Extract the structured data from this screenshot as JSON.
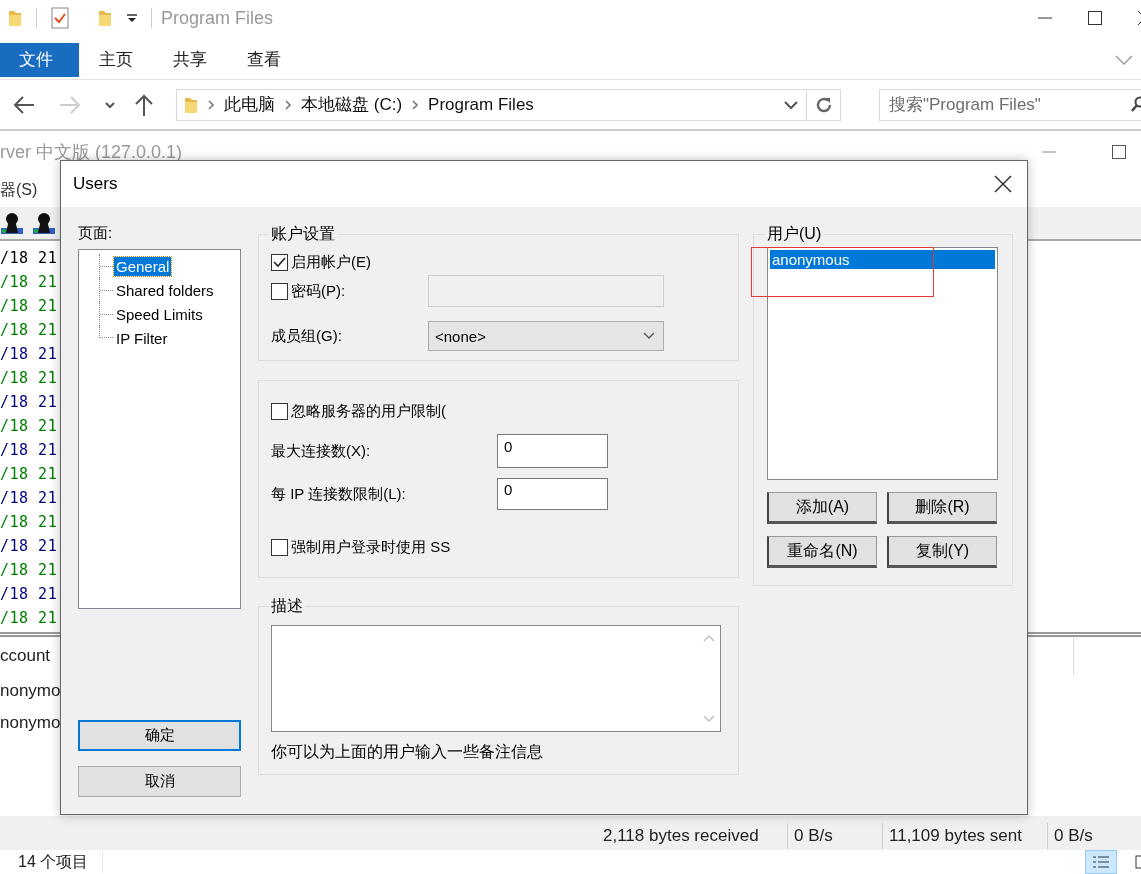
{
  "explorer": {
    "title": "Program Files",
    "ribbon_tabs": [
      {
        "label": "文件",
        "selected": true
      },
      {
        "label": "主页",
        "selected": false
      },
      {
        "label": "共享",
        "selected": false
      },
      {
        "label": "查看",
        "selected": false
      }
    ],
    "nav_buttons": [
      {
        "kind": "back",
        "disabled": false
      },
      {
        "kind": "forward",
        "disabled": true
      },
      {
        "kind": "recent",
        "disabled": false
      },
      {
        "kind": "up",
        "disabled": false
      }
    ],
    "breadcrumb": [
      "此电脑",
      "本地磁盘 (C:)",
      "Program Files"
    ],
    "search": {
      "placeholder": "搜索\"Program Files\""
    },
    "status": "14 个项目"
  },
  "server_window": {
    "title": "rver 中文版 (127.0.0.1)",
    "menu": [
      "器(S)"
    ],
    "log_lines": [
      {
        "text": "/18 21",
        "color": "#000000"
      },
      {
        "text": "/18 21",
        "color": "#008000"
      },
      {
        "text": "/18 21",
        "color": "#008000"
      },
      {
        "text": "/18 21",
        "color": "#008000"
      },
      {
        "text": "/18 21",
        "color": "#000080"
      },
      {
        "text": "/18 21",
        "color": "#008000"
      },
      {
        "text": "/18 21",
        "color": "#000080"
      },
      {
        "text": "/18 21",
        "color": "#008000"
      },
      {
        "text": "/18 21",
        "color": "#000080"
      },
      {
        "text": "/18 21",
        "color": "#008000"
      },
      {
        "text": "/18 21",
        "color": "#000080"
      },
      {
        "text": "/18 21",
        "color": "#008000"
      },
      {
        "text": "/18 21",
        "color": "#000080"
      },
      {
        "text": "/18 21",
        "color": "#008000"
      },
      {
        "text": "/18 21",
        "color": "#000080"
      },
      {
        "text": "/18 21",
        "color": "#008000"
      }
    ],
    "users_column": "ccount",
    "users": [
      "nonymo",
      "nonymo"
    ],
    "status_bar": [
      "2,118 bytes received",
      "0 B/s",
      "11,109 bytes sent",
      "0 B/s"
    ]
  },
  "dialog": {
    "title": "Users",
    "pages_label": "页面:",
    "pages": [
      {
        "label": "General",
        "selected": true
      },
      {
        "label": "Shared folders",
        "selected": false
      },
      {
        "label": "Speed Limits",
        "selected": false
      },
      {
        "label": "IP Filter",
        "selected": false
      }
    ],
    "ok": "确定",
    "cancel": "取消",
    "account_group": {
      "title": "账户设置",
      "enable": {
        "label": "启用帐户(E)",
        "checked": true
      },
      "password": {
        "label": "密码(P):",
        "checked": false
      },
      "group_label": "成员组(G):",
      "group_value": "<none>"
    },
    "limits_group": {
      "bypass": {
        "label": "忽略服务器的用户限制(",
        "checked": false
      },
      "max_label": "最大连接数(X):",
      "max_value": "0",
      "ip_label": "每 IP 连接数限制(L):",
      "ip_value": "0",
      "ssl": {
        "label": "强制用户登录时使用 SS",
        "checked": false
      }
    },
    "description_group": {
      "title": "描述",
      "hint": "你可以为上面的用户输入一些备注信息"
    },
    "users_group": {
      "title": "用户(U)",
      "users": [
        {
          "name": "anonymous",
          "selected": true
        }
      ],
      "buttons": [
        "添加(A)",
        "删除(R)",
        "重命名(N)",
        "复制(Y)"
      ]
    }
  }
}
